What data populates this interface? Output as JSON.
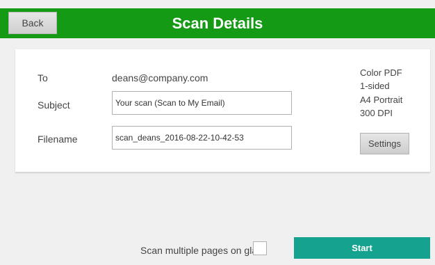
{
  "header": {
    "back_label": "Back",
    "title": "Scan Details"
  },
  "form": {
    "to_label": "To",
    "to_value": "deans@company.com",
    "subject_label": "Subject",
    "subject_value": "Your scan (Scan to My Email)",
    "filename_label": "Filename",
    "filename_value": "scan_deans_2016-08-22-10-42-53"
  },
  "options": {
    "color": "Color PDF",
    "sides": "1-sided",
    "paper": "A4 Portrait",
    "resolution": "300 DPI",
    "settings_label": "Settings"
  },
  "footer": {
    "multi_label": "Scan multiple pages on glass",
    "multi_checked": false,
    "start_label": "Start"
  },
  "colors": {
    "header_green": "#149a14",
    "start_teal": "#15a38f"
  }
}
